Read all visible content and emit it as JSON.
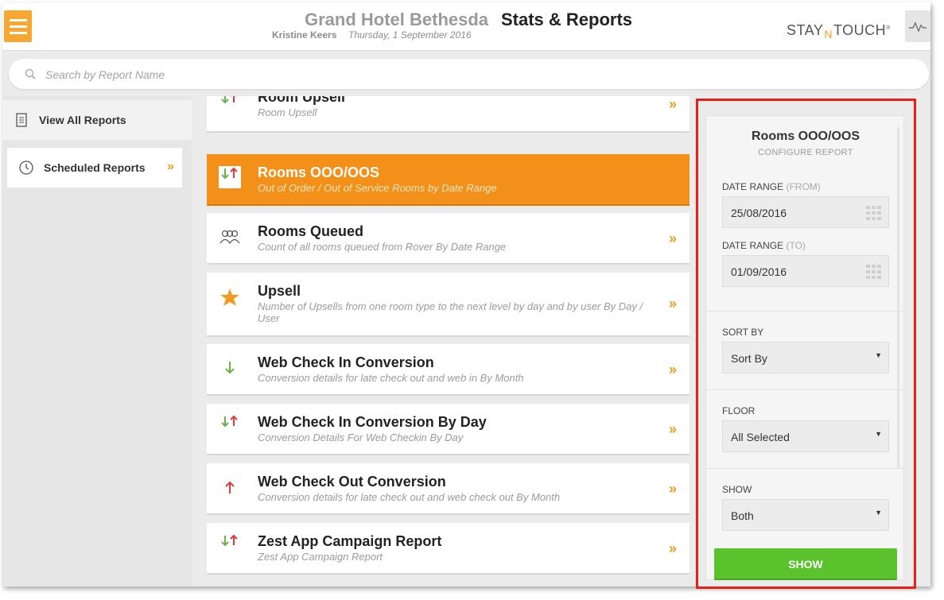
{
  "header": {
    "hotel_name": "Grand Hotel Bethesda",
    "page_title": "Stats & Reports",
    "user_name": "Kristine Keers",
    "date": "Thursday, 1 September 2016",
    "logo_left": "STAY",
    "logo_mid": "N",
    "logo_right": "TOUCH"
  },
  "search": {
    "placeholder": "Search by Report Name"
  },
  "leftnav": {
    "items": [
      {
        "label": "View All Reports"
      },
      {
        "label": "Scheduled Reports"
      }
    ]
  },
  "reports": [
    {
      "title": "Room Upsell",
      "desc": "Room Upsell",
      "icon": "up-down-arrows-icon"
    },
    {
      "title": "Rooms OOO/OOS",
      "desc": "Out of Order / Out of Service Rooms by Date Range",
      "icon": "up-down-arrows-icon"
    },
    {
      "title": "Rooms Queued",
      "desc": "Count of all rooms queued from Rover By Date Range",
      "icon": "people-icon"
    },
    {
      "title": "Upsell",
      "desc": "Number of Upsells from one room type to the next level by day and by user By Day / User",
      "icon": "star-icon"
    },
    {
      "title": "Web Check In Conversion",
      "desc": "Conversion details for late check out and web in By Month",
      "icon": "down-arrow-icon"
    },
    {
      "title": "Web Check In Conversion By Day",
      "desc": "Conversion Details For Web Checkin By Day",
      "icon": "up-down-arrows-icon"
    },
    {
      "title": "Web Check Out Conversion",
      "desc": "Conversion details for late check out and web check out By Month",
      "icon": "up-arrow-icon"
    },
    {
      "title": "Zest App Campaign Report",
      "desc": "Zest App Campaign Report",
      "icon": "up-down-arrows-icon"
    }
  ],
  "chevron": "»",
  "config": {
    "title": "Rooms OOO/OOS",
    "subtitle": "CONFIGURE REPORT",
    "date_from_label": "DATE RANGE",
    "date_from_hint": "(FROM)",
    "date_from_value": "25/08/2016",
    "date_to_label": "DATE RANGE",
    "date_to_hint": "(TO)",
    "date_to_value": "01/09/2016",
    "sort_label": "SORT BY",
    "sort_value": "Sort By",
    "floor_label": "FLOOR",
    "floor_value": "All Selected",
    "show_label": "SHOW",
    "show_value": "Both",
    "show_button": "SHOW"
  },
  "colors": {
    "accent": "#f39019",
    "go": "#59c22d",
    "highlight_box": "#e8201c",
    "arrow_up": "#e03a3a",
    "arrow_down": "#6ab04c"
  }
}
